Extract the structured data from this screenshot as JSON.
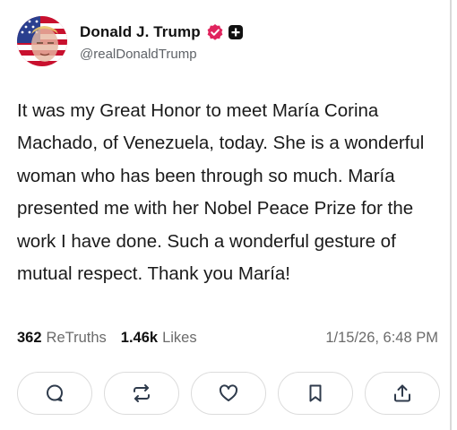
{
  "post": {
    "author": {
      "display_name": "Donald J. Trump",
      "handle": "@realDonaldTrump",
      "verified_badge_color": "#e0245e"
    },
    "text": "It was my Great Honor to meet María Corina Machado, of Venezuela, today. She is a wonderful woman who has been through so much. María presented me with her Nobel Peace Prize for the work I have done. Such a wonderful gesture of mutual respect. Thank you María!",
    "stats": {
      "retruths_count": "362",
      "retruths_label": "ReTruths",
      "likes_count": "1.46k",
      "likes_label": "Likes"
    },
    "timestamp": "1/15/26, 6:48 PM"
  },
  "actions": [
    "comment-icon",
    "retruth-icon",
    "like-icon",
    "bookmark-icon",
    "share-icon"
  ],
  "colors": {
    "text": "#111111",
    "muted": "#6b6b6b",
    "border": "#dcdcdc"
  }
}
